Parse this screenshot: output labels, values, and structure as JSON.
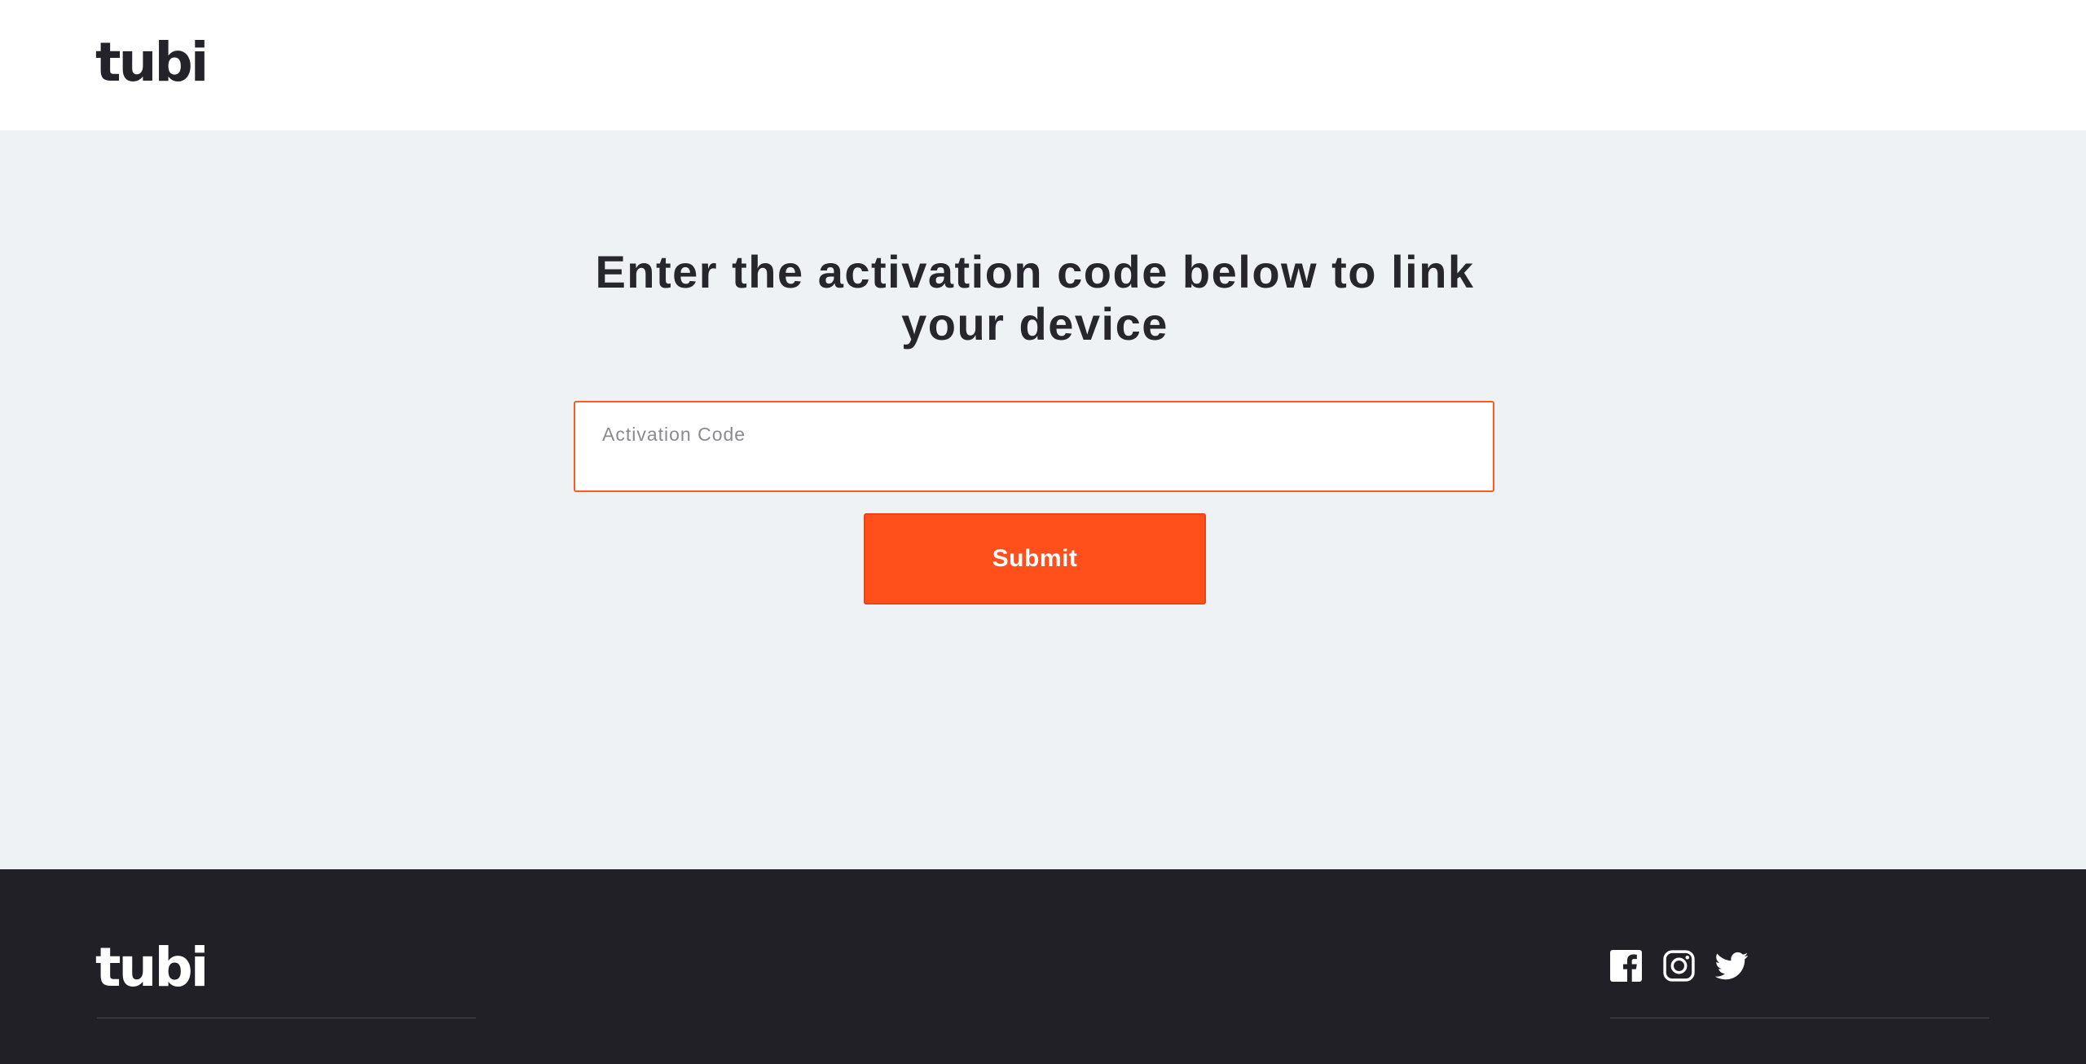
{
  "header": {
    "logo_text": "tubi"
  },
  "main": {
    "heading": "Enter the activation code below to link your device",
    "activation_field": {
      "label": "Activation Code",
      "value": ""
    },
    "submit_label": "Submit"
  },
  "footer": {
    "logo_text": "tubi",
    "social_icons": [
      "facebook-icon",
      "instagram-icon",
      "twitter-icon"
    ]
  },
  "colors": {
    "accent": "#ff501b",
    "header_bg": "#ffffff",
    "main_bg": "#eef2f5",
    "footer_bg": "#212026",
    "text_dark": "#26262c"
  }
}
